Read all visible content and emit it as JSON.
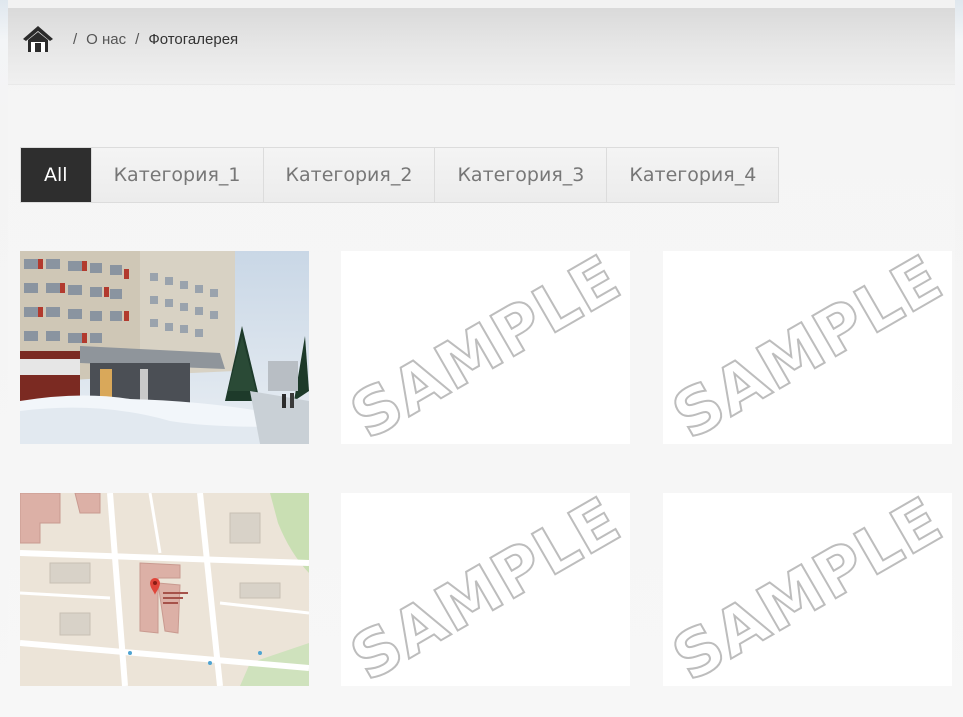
{
  "breadcrumb": {
    "home_icon": "home-icon",
    "items": [
      {
        "label": "О нас"
      },
      {
        "label": "Фотогалерея"
      }
    ],
    "separator": "/"
  },
  "filter_tabs": [
    {
      "label": "All",
      "active": true
    },
    {
      "label": "Категория_1",
      "active": false
    },
    {
      "label": "Категория_2",
      "active": false
    },
    {
      "label": "Категория_3",
      "active": false
    },
    {
      "label": "Категория_4",
      "active": false
    }
  ],
  "gallery": {
    "items": [
      {
        "type": "photo",
        "subject": "hospital-building-winter"
      },
      {
        "type": "placeholder",
        "text": "SAMPLE"
      },
      {
        "type": "placeholder",
        "text": "SAMPLE"
      },
      {
        "type": "photo",
        "subject": "map"
      },
      {
        "type": "placeholder",
        "text": "SAMPLE"
      },
      {
        "type": "placeholder",
        "text": "SAMPLE"
      }
    ]
  },
  "colors": {
    "active_tab_bg": "#2e2e2e",
    "active_tab_text": "#ffffff",
    "tab_text": "#777777",
    "watermark_stroke": "#bdbdbd"
  }
}
